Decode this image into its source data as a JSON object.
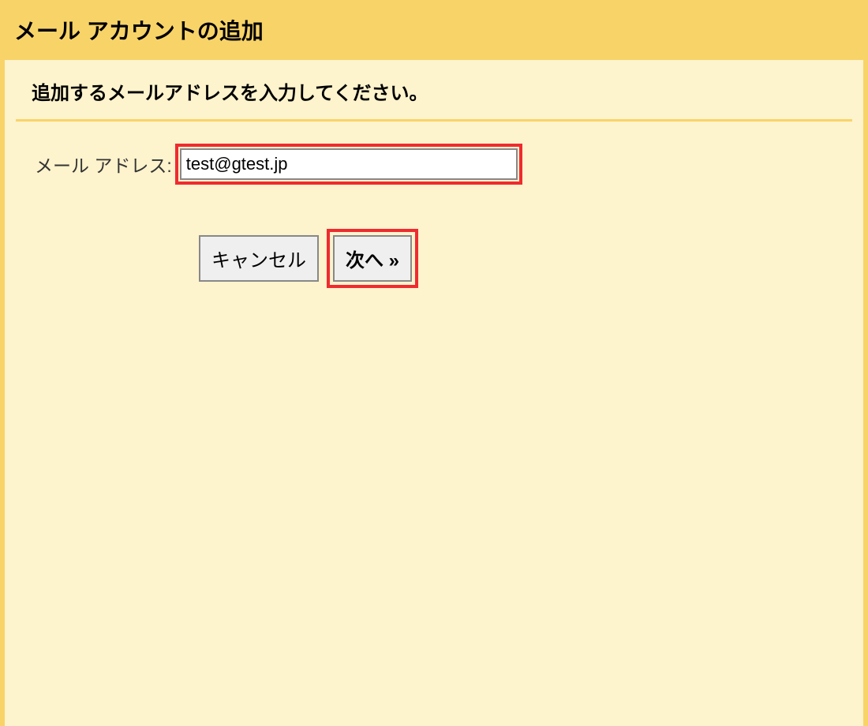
{
  "header": {
    "title": "メール アカウントの追加"
  },
  "subtitle": "追加するメールアドレスを入力してください。",
  "form": {
    "email_label": "メール アドレス:",
    "email_value": "test@gtest.jp"
  },
  "buttons": {
    "cancel": "キャンセル",
    "next": "次へ »"
  }
}
